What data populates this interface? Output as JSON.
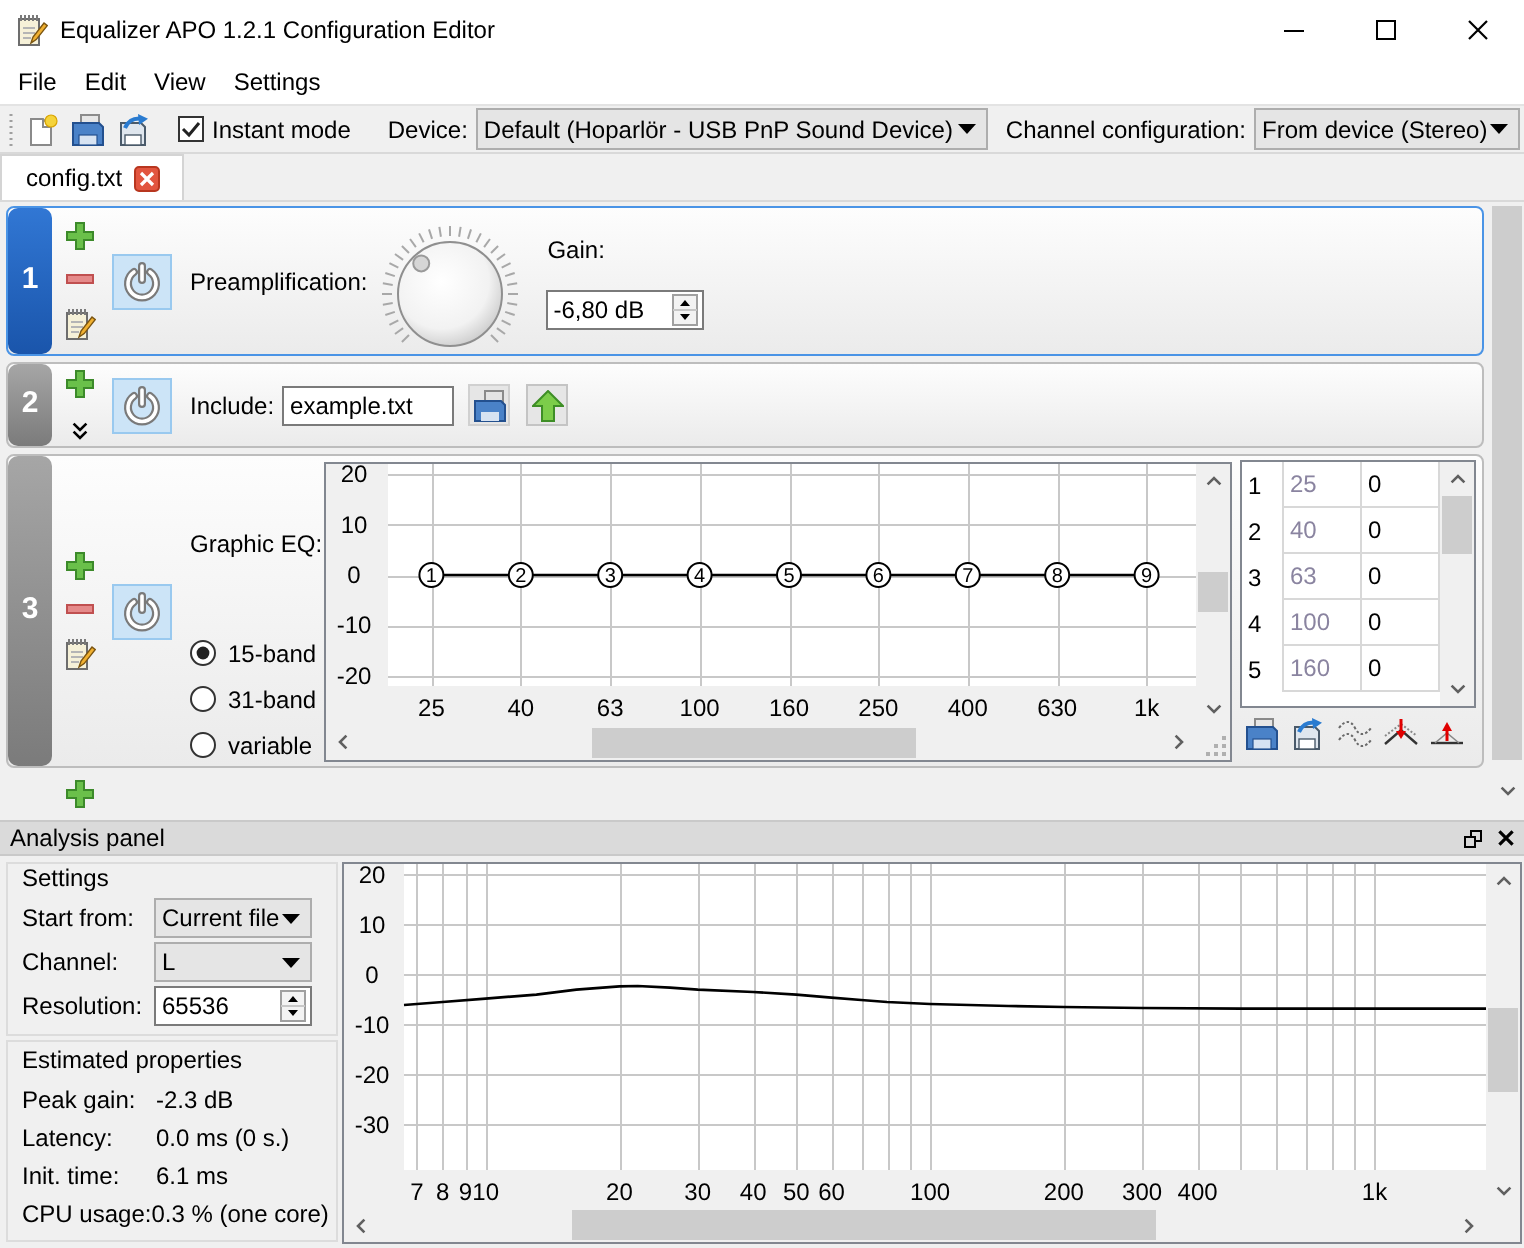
{
  "window": {
    "title": "Equalizer APO 1.2.1 Configuration Editor"
  },
  "menu": [
    "File",
    "Edit",
    "View",
    "Settings"
  ],
  "toolbar": {
    "instant_mode": {
      "label": "Instant mode",
      "checked": true
    },
    "device": {
      "label": "Device:",
      "value": "Default (Hoparlör - USB PnP Sound Device)"
    },
    "channel_configuration": {
      "label": "Channel configuration:",
      "value": "From device (Stereo)"
    }
  },
  "tabs": [
    {
      "label": "config.txt",
      "selected": true
    }
  ],
  "filters": [
    {
      "number": "1",
      "kind": "preamp",
      "selected": true,
      "enabled": true,
      "tools": [
        {
          "kind": "add"
        },
        {
          "kind": "remove"
        },
        {
          "kind": "edit"
        }
      ],
      "label": "Preamplification:",
      "level": 0.34,
      "gain": {
        "label": "Gain:",
        "value": "-6,80 dB"
      }
    },
    {
      "number": "2",
      "kind": "include",
      "selected": false,
      "enabled": true,
      "tools": [
        {
          "kind": "add"
        },
        {
          "kind": "expand"
        }
      ],
      "label": "Include:",
      "value": "example.txt"
    },
    {
      "number": "3",
      "kind": "graphic_eq",
      "selected": false,
      "enabled": true,
      "tools": [
        {
          "kind": "add"
        },
        {
          "kind": "remove"
        },
        {
          "kind": "edit"
        }
      ],
      "label": "Graphic EQ:",
      "band_modes": [
        {
          "label": "15-band",
          "selected": true
        },
        {
          "label": "31-band",
          "selected": false
        },
        {
          "label": "variable",
          "selected": false
        }
      ],
      "chart_data": {
        "type": "line",
        "grid": true,
        "categories": [
          "25",
          "40",
          "63",
          "100",
          "160",
          "250",
          "400",
          "630",
          "1k"
        ],
        "series": [
          {
            "color": "#000000",
            "marker": "circle",
            "values": [
              0,
              0,
              0,
              0,
              0,
              0,
              0,
              0,
              0
            ]
          }
        ],
        "ylim": [
          -22,
          22
        ],
        "yticks": [
          20,
          10,
          0,
          -10,
          -20
        ],
        "annotations": [
          {
            "y": 0,
            "text": "1"
          },
          {
            "y": 0,
            "text": "2"
          },
          {
            "y": 0,
            "text": "3"
          },
          {
            "y": 0,
            "text": "4"
          },
          {
            "y": 0,
            "text": "5"
          },
          {
            "y": 0,
            "text": "6"
          },
          {
            "y": 0,
            "text": "7"
          },
          {
            "y": 0,
            "text": "8"
          },
          {
            "y": 0,
            "text": "9"
          }
        ]
      },
      "bands": [
        {
          "cells": [
            "1",
            "25",
            "0"
          ]
        },
        {
          "cells": [
            "2",
            "40",
            "0"
          ]
        },
        {
          "cells": [
            "3",
            "63",
            "0"
          ]
        },
        {
          "cells": [
            "4",
            "100",
            "0"
          ]
        },
        {
          "cells": [
            "5",
            "160",
            "0"
          ]
        }
      ]
    }
  ],
  "analysis_panel": {
    "title": "Analysis panel",
    "settings": {
      "title": "Settings",
      "fields": [
        {
          "kind": "dropdown",
          "label": "Start from:",
          "value": "Current file"
        },
        {
          "kind": "dropdown",
          "label": "Channel:",
          "value": "L"
        },
        {
          "kind": "spinbox",
          "label": "Resolution:",
          "value": "65536"
        }
      ]
    },
    "estimated_properties": {
      "title": "Estimated properties",
      "rows": [
        {
          "label": "Peak gain:",
          "value": "-2.3 dB"
        },
        {
          "label": "Latency:",
          "value": "0.0 ms (0 s.)"
        },
        {
          "label": "Init. time:",
          "value": "6.1 ms"
        },
        {
          "label": "CPU usage:",
          "value": "0.3 % (one core)"
        }
      ]
    },
    "chart_data": {
      "type": "line",
      "grid": true,
      "log": "x",
      "x": [
        6.55,
        8,
        10,
        13,
        16,
        20,
        22,
        26,
        30,
        40,
        50,
        60,
        70,
        80,
        100,
        150,
        200,
        300,
        500,
        1782
      ],
      "series": [
        {
          "color": "#000000",
          "values": [
            -6.1,
            -5.5,
            -4.8,
            -4.0,
            -3.0,
            -2.4,
            -2.3,
            -2.6,
            -3.0,
            -3.5,
            -4.0,
            -4.6,
            -5.1,
            -5.5,
            -5.9,
            -6.3,
            -6.5,
            -6.7,
            -6.8,
            -6.8
          ]
        }
      ],
      "xlim": [
        6.55,
        1782
      ],
      "ylim": [
        -39.1,
        22.1
      ],
      "xticks": [
        {
          "value": 7,
          "label": "7"
        },
        {
          "value": 8,
          "label": "8"
        },
        {
          "value": 9,
          "label": "9"
        },
        {
          "value": 10,
          "label": "10"
        },
        {
          "value": 20,
          "label": "20"
        },
        {
          "value": 30,
          "label": "30"
        },
        {
          "value": 40,
          "label": "40"
        },
        {
          "value": 50,
          "label": "50"
        },
        {
          "value": 60,
          "label": "60"
        },
        {
          "value": 100,
          "label": "100"
        },
        {
          "value": 200,
          "label": "200"
        },
        {
          "value": 300,
          "label": "300"
        },
        {
          "value": 400,
          "label": "400"
        },
        {
          "value": 1000,
          "label": "1k"
        }
      ],
      "yticks": [
        20,
        10,
        0,
        -10,
        -20,
        -30
      ]
    }
  }
}
